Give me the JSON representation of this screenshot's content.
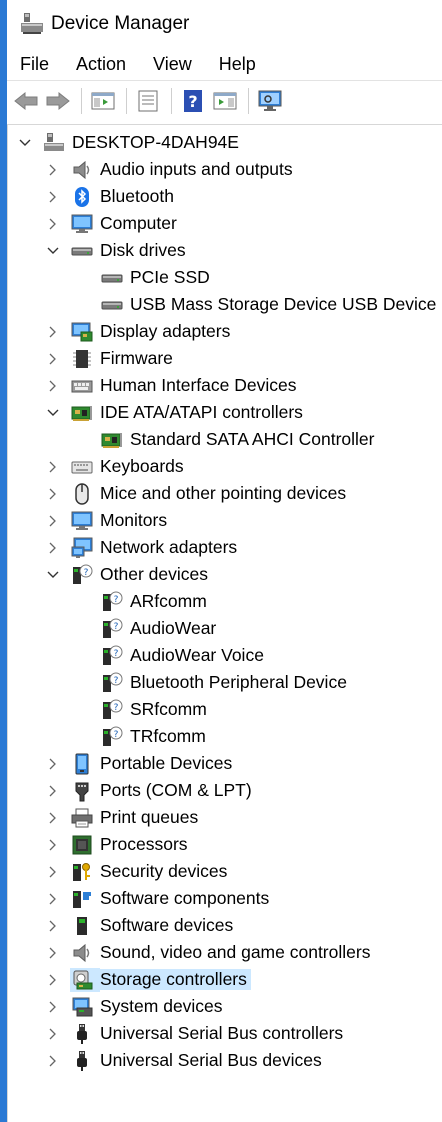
{
  "window": {
    "title": "Device Manager"
  },
  "menu": [
    "File",
    "Action",
    "View",
    "Help"
  ],
  "toolbar": [
    "back-icon",
    "forward-icon",
    "show-hide-console-tree-icon",
    "properties-icon",
    "help-icon",
    "action-pane-icon",
    "scan-hardware-icon"
  ],
  "tree": {
    "root": "DESKTOP-4DAH94E",
    "items": [
      {
        "label": "Audio inputs and outputs",
        "icon": "speaker-icon",
        "state": "collapsed"
      },
      {
        "label": "Bluetooth",
        "icon": "bluetooth-icon",
        "state": "collapsed"
      },
      {
        "label": "Computer",
        "icon": "monitor-icon",
        "state": "collapsed"
      },
      {
        "label": "Disk drives",
        "icon": "drive-icon",
        "state": "expanded",
        "children": [
          {
            "label": "PCIe SSD",
            "icon": "drive-icon"
          },
          {
            "label": "USB Mass  Storage Device USB Device",
            "icon": "drive-icon"
          }
        ]
      },
      {
        "label": "Display adapters",
        "icon": "display-adapter-icon",
        "state": "collapsed"
      },
      {
        "label": "Firmware",
        "icon": "chip-icon",
        "state": "collapsed"
      },
      {
        "label": "Human Interface Devices",
        "icon": "hid-icon",
        "state": "collapsed"
      },
      {
        "label": "IDE ATA/ATAPI controllers",
        "icon": "controller-card-icon",
        "state": "expanded",
        "children": [
          {
            "label": "Standard SATA AHCI Controller",
            "icon": "controller-card-icon"
          }
        ]
      },
      {
        "label": "Keyboards",
        "icon": "keyboard-icon",
        "state": "collapsed"
      },
      {
        "label": "Mice and other pointing devices",
        "icon": "mouse-icon",
        "state": "collapsed"
      },
      {
        "label": "Monitors",
        "icon": "monitor-icon",
        "state": "collapsed"
      },
      {
        "label": "Network adapters",
        "icon": "network-icon",
        "state": "collapsed"
      },
      {
        "label": "Other devices",
        "icon": "unknown-device-icon",
        "state": "expanded",
        "children": [
          {
            "label": "ARfcomm",
            "icon": "unknown-device-icon"
          },
          {
            "label": "AudioWear",
            "icon": "unknown-device-icon"
          },
          {
            "label": "AudioWear Voice",
            "icon": "unknown-device-icon"
          },
          {
            "label": "Bluetooth Peripheral Device",
            "icon": "unknown-device-icon"
          },
          {
            "label": "SRfcomm",
            "icon": "unknown-device-icon"
          },
          {
            "label": "TRfcomm",
            "icon": "unknown-device-icon"
          }
        ]
      },
      {
        "label": "Portable Devices",
        "icon": "portable-device-icon",
        "state": "collapsed"
      },
      {
        "label": "Ports (COM & LPT)",
        "icon": "port-icon",
        "state": "collapsed"
      },
      {
        "label": "Print queues",
        "icon": "printer-icon",
        "state": "collapsed"
      },
      {
        "label": "Processors",
        "icon": "processor-icon",
        "state": "collapsed"
      },
      {
        "label": "Security devices",
        "icon": "security-device-icon",
        "state": "collapsed"
      },
      {
        "label": "Software components",
        "icon": "software-component-icon",
        "state": "collapsed"
      },
      {
        "label": "Software devices",
        "icon": "software-device-icon",
        "state": "collapsed"
      },
      {
        "label": "Sound, video and game controllers",
        "icon": "speaker-icon",
        "state": "collapsed"
      },
      {
        "label": "Storage controllers",
        "icon": "storage-controller-icon",
        "state": "collapsed",
        "selected": true
      },
      {
        "label": "System devices",
        "icon": "system-device-icon",
        "state": "collapsed"
      },
      {
        "label": "Universal Serial Bus controllers",
        "icon": "usb-icon",
        "state": "collapsed"
      },
      {
        "label": "Universal Serial Bus devices",
        "icon": "usb-icon",
        "state": "collapsed"
      }
    ]
  },
  "colors": {
    "accent_bar": "#2a79d4",
    "selection": "#cce8ff"
  }
}
